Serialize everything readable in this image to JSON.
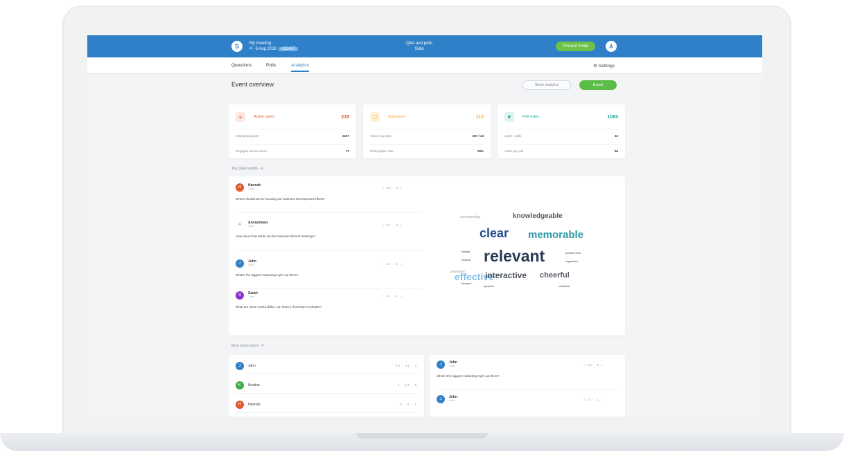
{
  "colors": {
    "brand": "#2f80c8",
    "green": "#5bbd47",
    "red": "#e2572b",
    "amber": "#f2a93b",
    "teal": "#1aa58f"
  },
  "topbar": {
    "logo_glyph": "S",
    "event_name": "My meeting",
    "event_dates": "4 - 6 Aug 2018",
    "event_code": "#22457",
    "center_title": "Q&A and polls",
    "center_sub": "Slido",
    "present_label": "Present mode",
    "user_initial": "A"
  },
  "tabs": {
    "questions": "Questions",
    "polls": "Polls",
    "analytics": "Analytics",
    "settings": "⚙ Settings"
  },
  "overview": {
    "title": "Event overview",
    "secondary_button": "Share analytics",
    "export_button": "Export"
  },
  "cards": [
    {
      "icon": "≡",
      "title": "Active users",
      "total": "215",
      "rows": [
        {
          "label": "Total participants",
          "value": "2187"
        },
        {
          "label": "Engaged across users",
          "value": "72"
        }
      ]
    },
    {
      "icon": "☐",
      "title": "Questions",
      "total": "112",
      "rows": [
        {
          "label": "Votes / upvotes",
          "value": "287 / 43"
        },
        {
          "label": "Participation rate",
          "value": "28%"
        }
      ]
    },
    {
      "icon": "▼",
      "title": "Poll votes",
      "total": "1093",
      "rows": [
        {
          "label": "Votes / polls",
          "value": "34"
        },
        {
          "label": "Votes per poll",
          "value": "96"
        }
      ]
    }
  ],
  "qa": {
    "label": "Top Q&A insights · 4",
    "questions": [
      {
        "initial": "H",
        "name": "Hannah",
        "time": "2 min",
        "meta": "↑ 38 · 4 ⌂",
        "text": "Where should we be focusing our business development efforts?"
      },
      {
        "initial": "A",
        "name": "Anonymous",
        "time": "4 min",
        "meta": "↑ 21 · 4 ⌂",
        "text": "How does Chat Mode can be fastened efficient meetings?"
      },
      {
        "initial": "J",
        "name": "John",
        "time": "5 min",
        "meta": "↑ 18 · 2 ⌂",
        "text": "What's the biggest marketing myth out there?"
      },
      {
        "initial": "S",
        "name": "Sarah",
        "time": "7 min",
        "meta": "↑ 11 · 1 ⌂",
        "text": "What are some useful skills I can learn in less than 5 minutes?"
      }
    ],
    "cloud": [
      {
        "text": "commanding",
        "color": "#9aa0a8",
        "size": 5
      },
      {
        "text": "knowledgeable",
        "color": "#555b63",
        "size": 10
      },
      {
        "text": "clear",
        "color": "#1f4e8c",
        "size": 18
      },
      {
        "text": "memorable",
        "color": "#2c9aa8",
        "size": 15
      },
      {
        "text": "relevant",
        "color": "#2a3a55",
        "size": 23
      },
      {
        "text": "effective",
        "color": "#7fc0e8",
        "size": 14
      },
      {
        "text": "interactive",
        "color": "#4a5058",
        "size": 12
      },
      {
        "text": "cheerful",
        "color": "#555b63",
        "size": 11
      },
      {
        "text": "animated",
        "color": "#9aa0a8",
        "size": 5
      },
      {
        "text": "present time",
        "color": "#333",
        "size": 4
      },
      {
        "text": "organized",
        "color": "#333",
        "size": 4
      },
      {
        "text": "natural",
        "color": "#333",
        "size": 4
      },
      {
        "text": "relaxed",
        "color": "#333",
        "size": 4
      },
      {
        "text": "focused",
        "color": "#333",
        "size": 4
      },
      {
        "text": "dynamic",
        "color": "#333",
        "size": 4
      },
      {
        "text": "confident",
        "color": "#333",
        "size": 4
      }
    ]
  },
  "wall": {
    "label": "Most active users · 4",
    "left": [
      {
        "initial": "J",
        "name": "John",
        "meta": "36 · 11 · 4"
      },
      {
        "initial": "K",
        "name": "Kristina",
        "meta": "4 · 12 · 0"
      },
      {
        "initial": "H",
        "name": "Hannah",
        "meta": "6 · 8 · 1"
      }
    ],
    "right": [
      {
        "initial": "J",
        "name": "John",
        "time": "5 min",
        "meta": "↑ 18 · 2 ⌂",
        "text": "What's the biggest marketing myth out there?"
      },
      {
        "initial": "J",
        "name": "John",
        "time": "6 min",
        "meta": "↑ 14 · 1 ⌂"
      }
    ]
  }
}
